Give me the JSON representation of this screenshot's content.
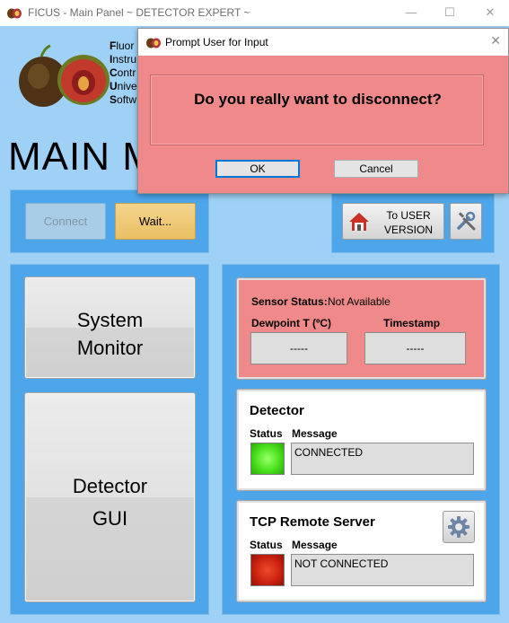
{
  "window": {
    "title": "FICUS - Main Panel ~ DETECTOR EXPERT ~",
    "minimize": "—",
    "maximize": "☐",
    "close": "✕"
  },
  "logo": {
    "lines": [
      {
        "initial": "F",
        "rest": "luor"
      },
      {
        "initial": "I",
        "rest": "nstru"
      },
      {
        "initial": "C",
        "rest": "ontr"
      },
      {
        "initial": "U",
        "rest": "nive"
      },
      {
        "initial": "S",
        "rest": "oftw"
      }
    ]
  },
  "main_title": "MAIN M",
  "connection": {
    "connect_label": "Connect",
    "wait_label": "Wait..."
  },
  "user_version": {
    "line1": "To USER",
    "line2": "VERSION",
    "icon": "home-icon"
  },
  "tools": {
    "icon": "tools-icon"
  },
  "nav": {
    "system_monitor": {
      "line1": "System",
      "line2": "Monitor"
    },
    "detector_gui": {
      "line1": "Detector",
      "line2": "GUI"
    }
  },
  "sensor": {
    "status_label": "Sensor Status:",
    "status_value": "Not Available",
    "dewpoint_label": "Dewpoint T (ºC)",
    "timestamp_label": "Timestamp",
    "dewpoint_value": "-----",
    "timestamp_value": "-----"
  },
  "detector": {
    "title": "Detector",
    "status_label": "Status",
    "message_label": "Message",
    "message": "CONNECTED",
    "led_color": "#49e21c"
  },
  "tcp": {
    "title": "TCP Remote Server",
    "status_label": "Status",
    "message_label": "Message",
    "message": "NOT CONNECTED",
    "led_color": "#c8200e",
    "settings_icon": "gear-icon"
  },
  "dialog": {
    "title": "Prompt User for Input",
    "message": "Do you really want to disconnect?",
    "ok_label": "OK",
    "cancel_label": "Cancel",
    "close": "✕"
  },
  "colors": {
    "panel_bg": "#9fd1f6",
    "section_bg": "#4da6ea",
    "alert_bg": "#f08a8a",
    "wait_button": "#e9c064"
  }
}
